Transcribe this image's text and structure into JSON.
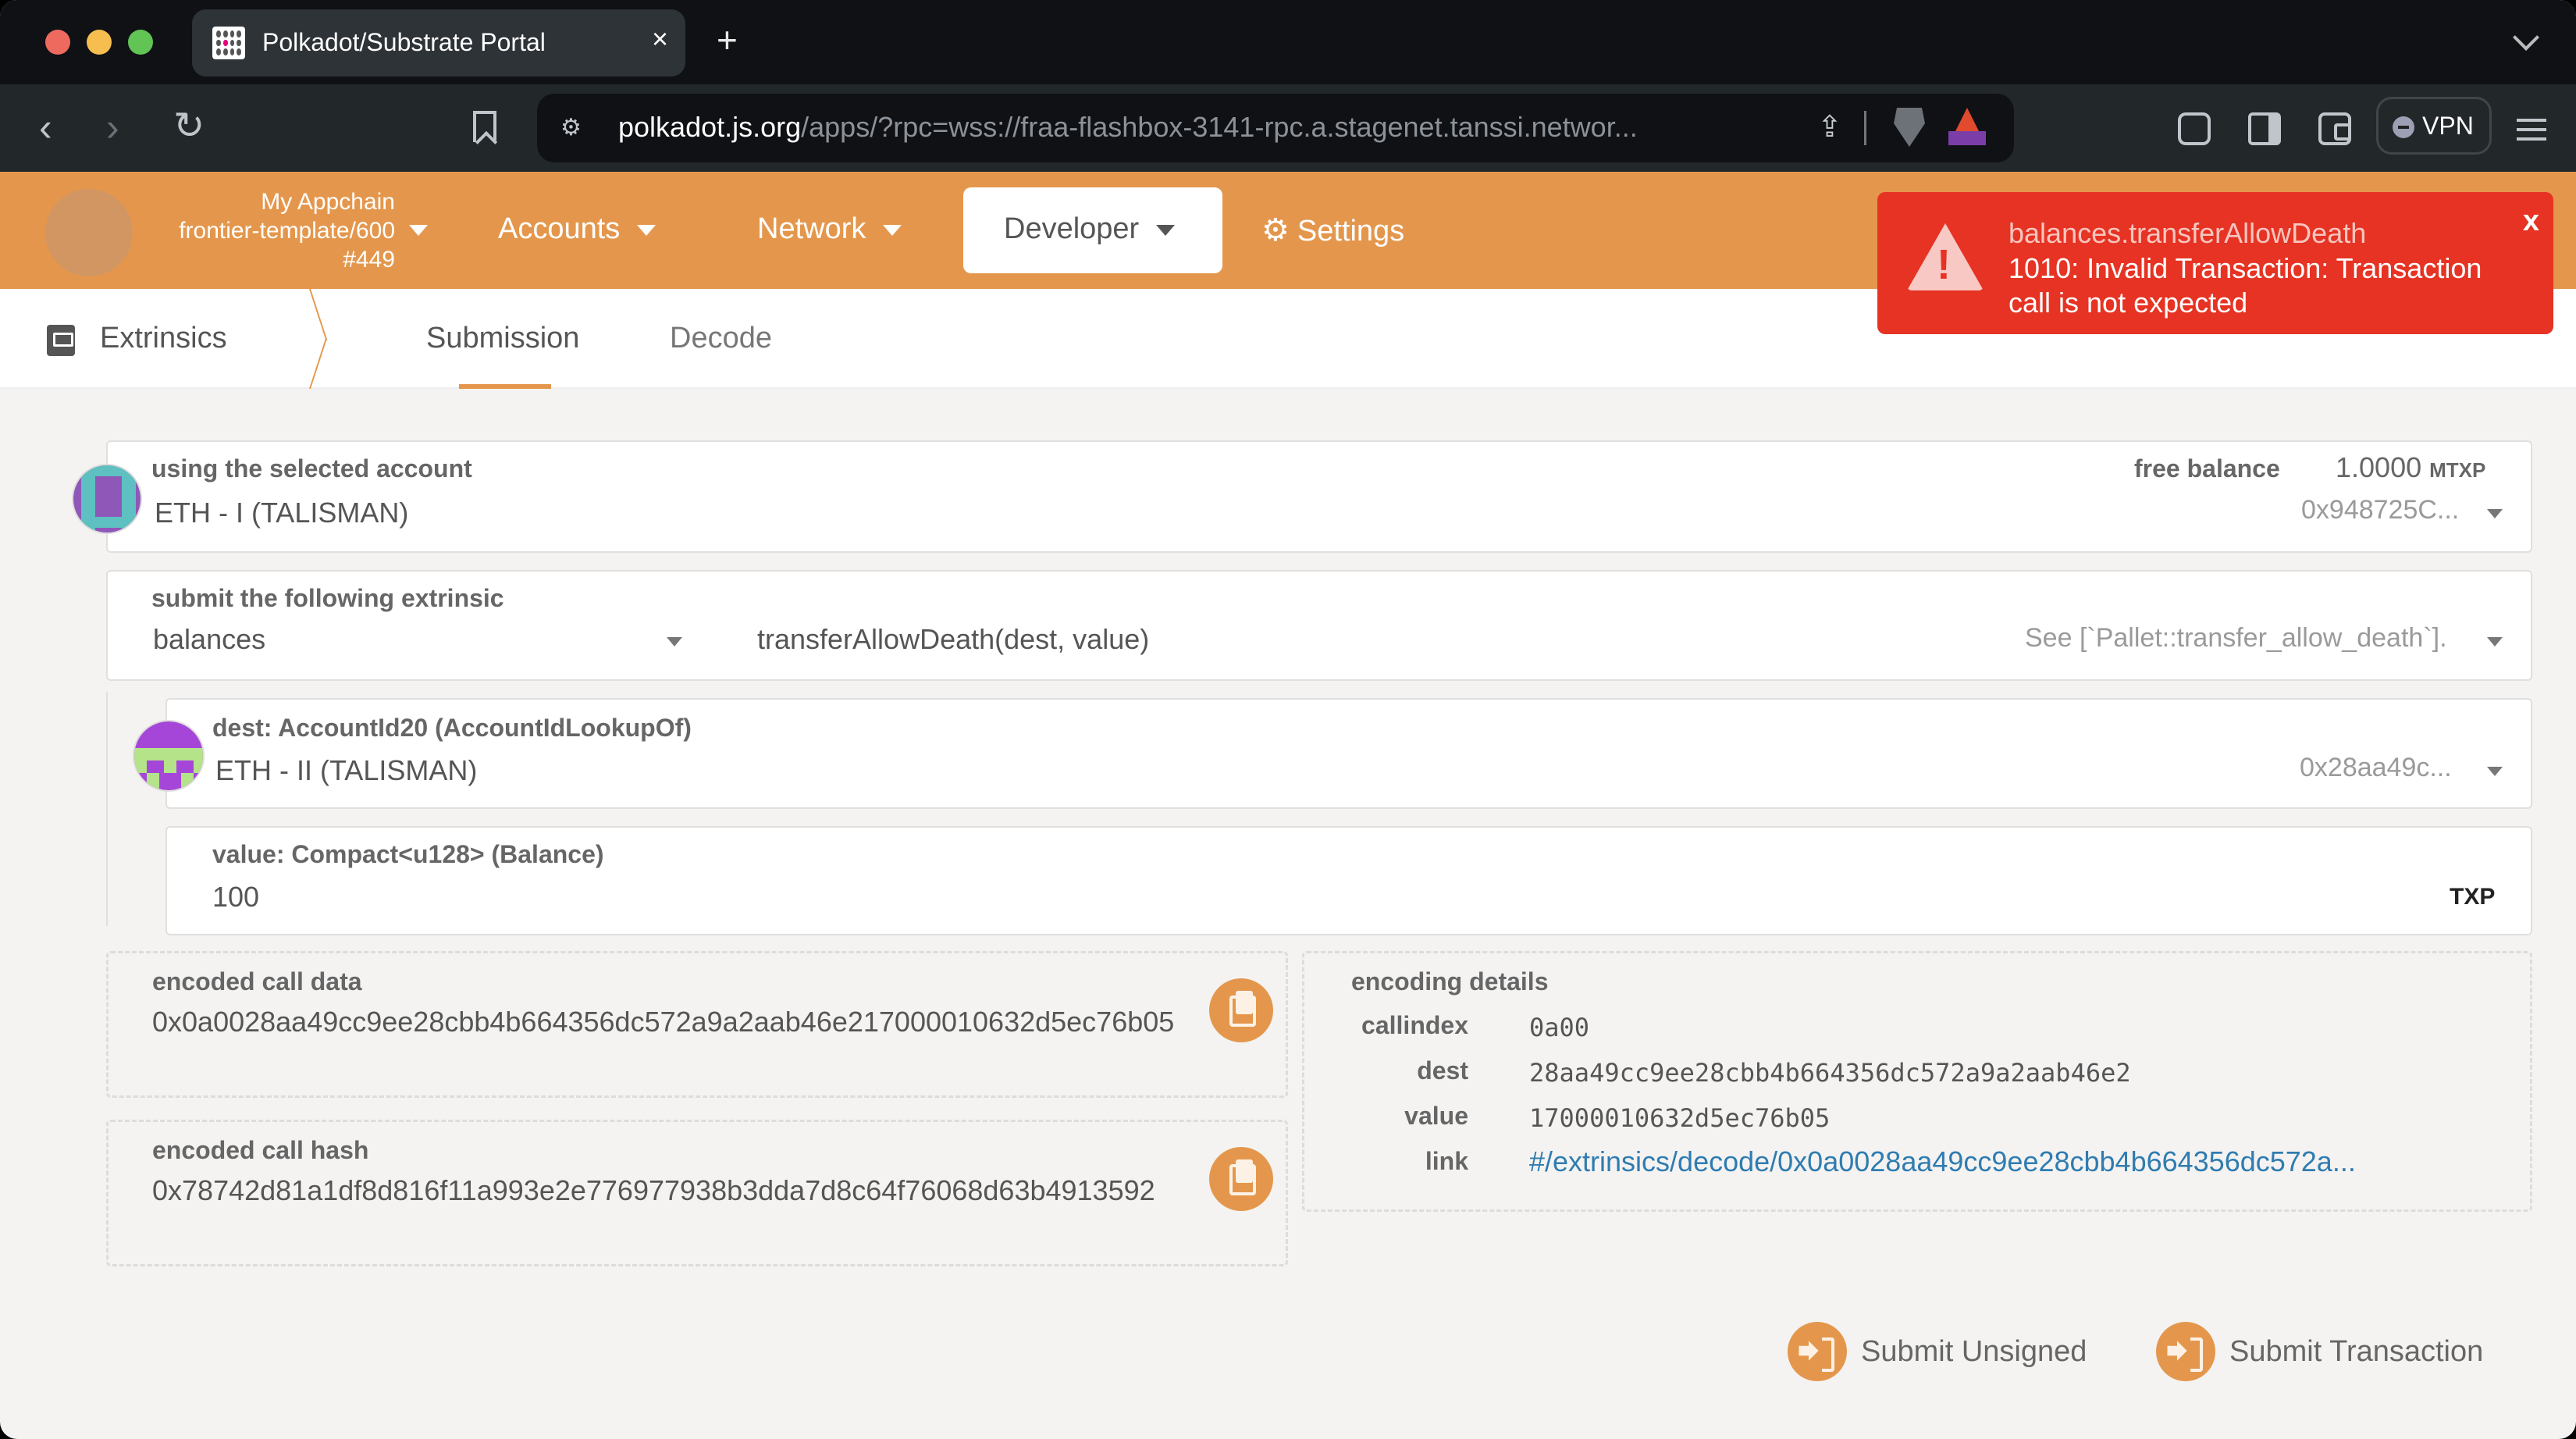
{
  "browser": {
    "tab_title": "Polkadot/Substrate Portal",
    "url_host": "polkadot.js.org",
    "url_path": "/apps/?rpc=wss://fraa-flashbox-3141-rpc.a.stagenet.tanssi.networ...",
    "vpn_label": "VPN",
    "icons": [
      "back-icon",
      "forward-icon",
      "reload-icon",
      "bookmark-icon",
      "site-settings-icon",
      "share-icon",
      "brave-shields-icon",
      "brave-rewards-icon",
      "extensions-icon",
      "sidebar-icon",
      "wallet-icon",
      "menu-icon"
    ]
  },
  "appnav": {
    "chain_name": "My Appchain",
    "chain_spec": "frontier-template/600",
    "block": "#449",
    "items": [
      {
        "label": "Accounts"
      },
      {
        "label": "Network"
      },
      {
        "label": "Developer",
        "active": true
      },
      {
        "label": "Settings"
      }
    ],
    "accent_color": "#e4974c"
  },
  "toast": {
    "title": "balances.transferAllowDeath",
    "message": "1010: Invalid Transaction: Transaction call is not expected",
    "close": "x",
    "color": "#e63323"
  },
  "subnav": {
    "section": "Extrinsics",
    "tabs": [
      {
        "label": "Submission",
        "active": true
      },
      {
        "label": "Decode",
        "active": false
      }
    ]
  },
  "account": {
    "label": "using the selected account",
    "name": "ETH - I (TALISMAN)",
    "balance_label": "free balance",
    "balance_value": "1.0000",
    "balance_unit": "MTXP",
    "address": "0x948725C..."
  },
  "extrinsic": {
    "label": "submit the following extrinsic",
    "pallet": "balances",
    "call": "transferAllowDeath(dest, value)",
    "doc": "See [`Pallet::transfer_allow_death`]."
  },
  "params": {
    "dest": {
      "label": "dest: AccountId20 (AccountIdLookupOf)",
      "name": "ETH - II (TALISMAN)",
      "address": "0x28aa49c..."
    },
    "value": {
      "label": "value: Compact<u128> (Balance)",
      "amount": "100",
      "unit": "TXP"
    }
  },
  "encoded": {
    "call_data_label": "encoded call data",
    "call_data": "0x0a0028aa49cc9ee28cbb4b664356dc572a9a2aab46e217000010632d5ec76b05",
    "call_hash_label": "encoded call hash",
    "call_hash": "0x78742d81a1df8d816f11a993e2e776977938b3dda7d8c64f76068d63b4913592"
  },
  "encoding_details": {
    "title": "encoding details",
    "rows": [
      {
        "key": "callindex",
        "value": "0a00"
      },
      {
        "key": "dest",
        "value": "28aa49cc9ee28cbb4b664356dc572a9a2aab46e2"
      },
      {
        "key": "value",
        "value": "17000010632d5ec76b05"
      },
      {
        "key": "link",
        "value": "#/extrinsics/decode/0x0a0028aa49cc9ee28cbb4b664356dc572a..."
      }
    ]
  },
  "actions": {
    "submit_unsigned": "Submit Unsigned",
    "submit_transaction": "Submit Transaction"
  }
}
